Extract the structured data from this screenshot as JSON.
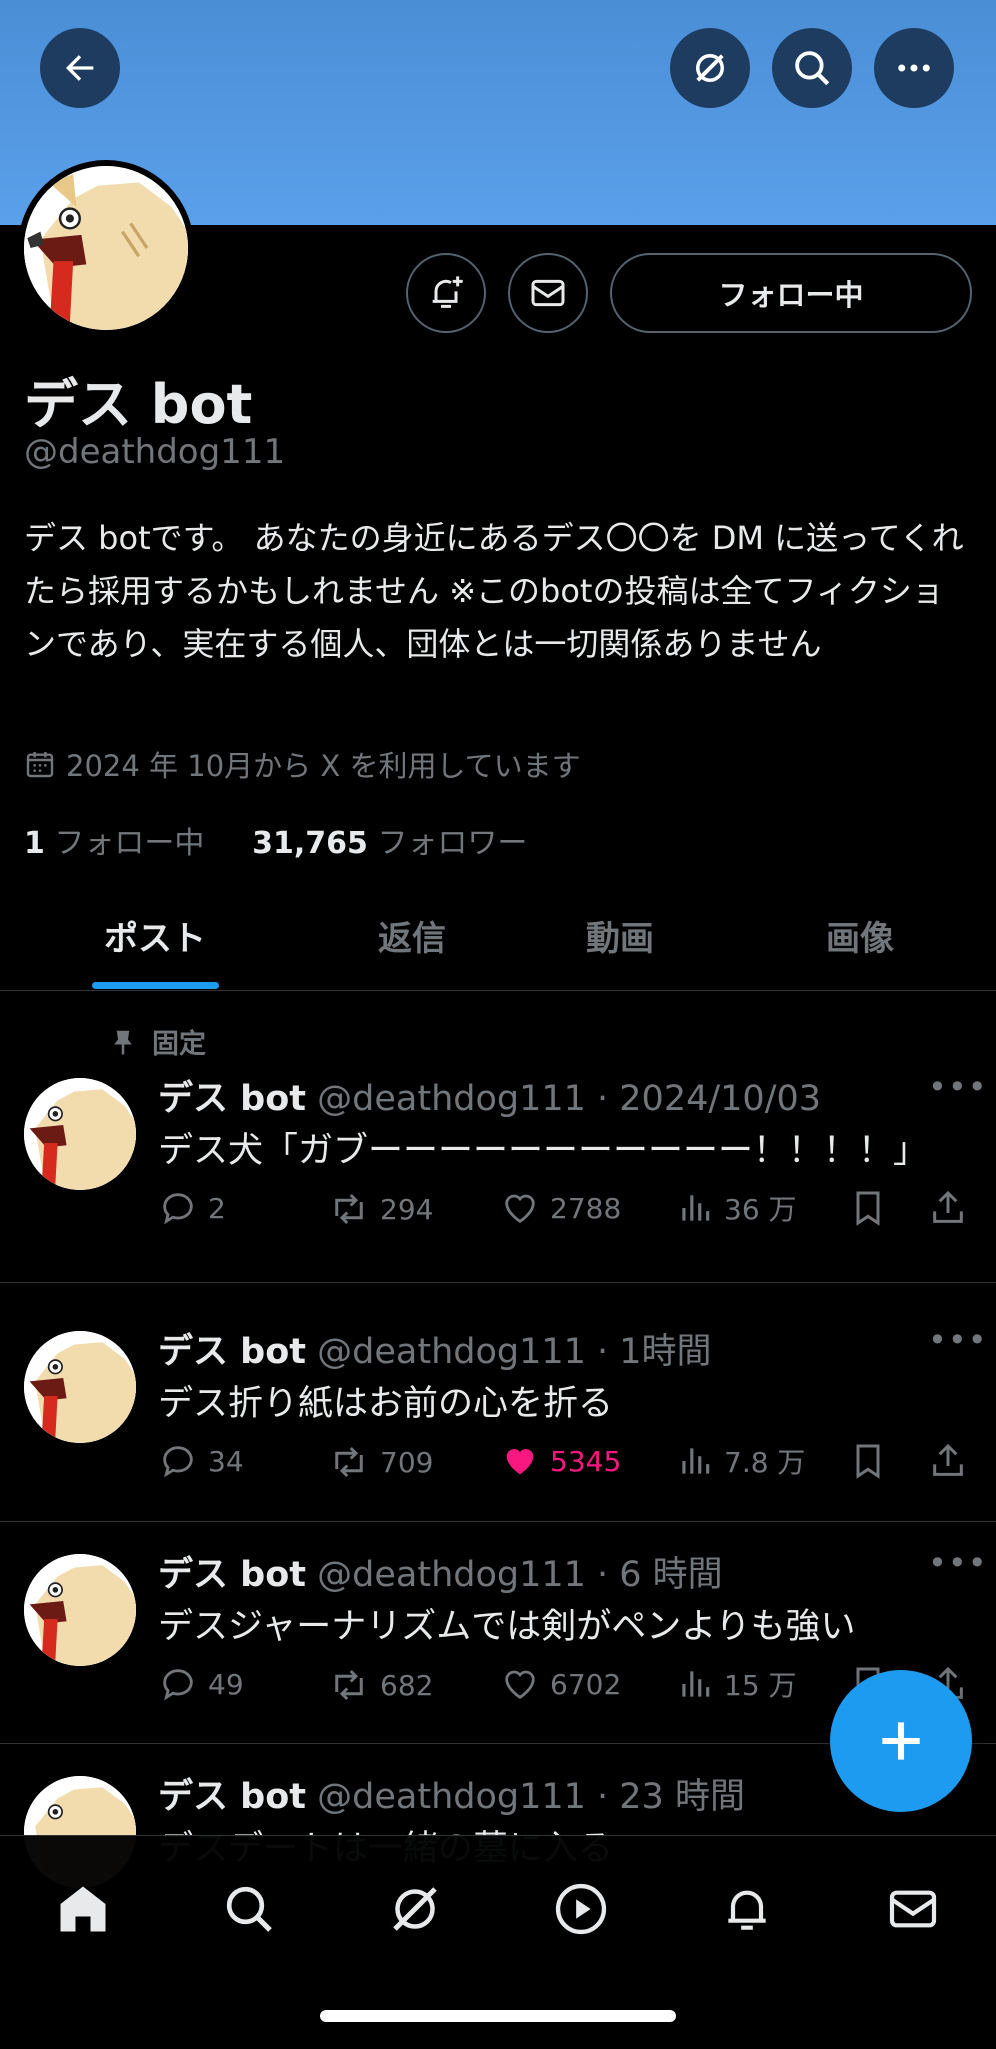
{
  "profile": {
    "name": "デス bot",
    "handle": "@deathdog111",
    "bio": "デス botです。 あなたの身近にあるデス〇〇を DM に送ってくれたら採用するかもしれません ※このbotの投稿は全てフィクションであり、実在する個人、団体とは一切関係ありません",
    "joined": "2024 年 10月から X を利用しています",
    "following_count": "1",
    "following_label": "フォロー中",
    "followers_count": "31,765",
    "followers_label": "フォロワー",
    "follow_button": "フォロー中"
  },
  "tabs": [
    {
      "label": "ポスト"
    },
    {
      "label": "返信"
    },
    {
      "label": "動画"
    },
    {
      "label": "画像"
    }
  ],
  "pinned_label": "固定",
  "posts": [
    {
      "name": "デス bot",
      "meta": "@deathdog111 · 2024/10/03",
      "text": "デス犬「ガブーーーーーーーーーーー！！！！」",
      "replies": "2",
      "reposts": "294",
      "likes": "2788",
      "views": "36 万",
      "liked": false
    },
    {
      "name": "デス bot",
      "meta": "@deathdog111 · 1時間",
      "text": "デス折り紙はお前の心を折る",
      "replies": "34",
      "reposts": "709",
      "likes": "5345",
      "views": "7.8 万",
      "liked": true
    },
    {
      "name": "デス bot",
      "meta": "@deathdog111 · 6 時間",
      "text": "デスジャーナリズムでは剣がペンよりも強い",
      "replies": "49",
      "reposts": "682",
      "likes": "6702",
      "views": "15 万",
      "liked": false
    },
    {
      "name": "デス bot",
      "meta": "@deathdog111 · 23 時間",
      "text": "デスデートは一緒の墓に入る"
    }
  ],
  "colors": {
    "banner": "#4a8ed6",
    "accent": "#1d9bf0",
    "like": "#f91880",
    "muted": "#71767b"
  },
  "icons": [
    "back-arrow-icon",
    "grok-icon",
    "search-icon",
    "more-icon",
    "bell-plus-icon",
    "mail-icon",
    "calendar-icon",
    "pin-icon",
    "reply-icon",
    "repost-icon",
    "heart-icon",
    "views-icon",
    "bookmark-icon",
    "share-icon",
    "plus-icon",
    "home-icon",
    "notifications-icon",
    "play-icon"
  ]
}
